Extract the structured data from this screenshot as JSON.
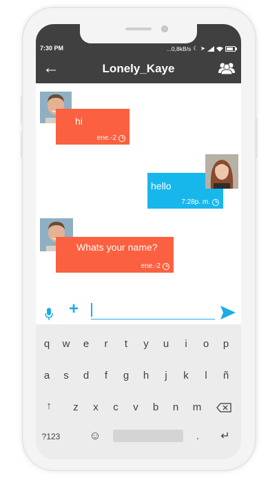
{
  "status_bar": {
    "time": "7:30 PM",
    "right_text": "...0,8kB/s"
  },
  "app_bar": {
    "title": "Lonely_Kaye"
  },
  "messages": [
    {
      "text": "hi",
      "time": "ene.-2",
      "color": "#fb6040"
    },
    {
      "text": "hello",
      "time": "7:28p. m.",
      "color": "#17b7ec"
    },
    {
      "text": "Whats your name?",
      "time": "ene.-2",
      "color": "#fb6040"
    }
  ],
  "input": {
    "value": "",
    "placeholder": ""
  },
  "keyboard": {
    "row1": [
      "q",
      "w",
      "e",
      "r",
      "t",
      "y",
      "u",
      "i",
      "o",
      "p"
    ],
    "row2": [
      "a",
      "s",
      "d",
      "f",
      "g",
      "h",
      "j",
      "k",
      "l",
      "ñ"
    ],
    "row3": [
      "z",
      "x",
      "c",
      "v",
      "b",
      "n",
      "m"
    ],
    "symbols": "?123",
    "period": "."
  },
  "colors": {
    "accent": "#1aaee7",
    "bubble_out": "#fb6040",
    "bubble_in": "#17b7ec",
    "bar": "#404040"
  }
}
